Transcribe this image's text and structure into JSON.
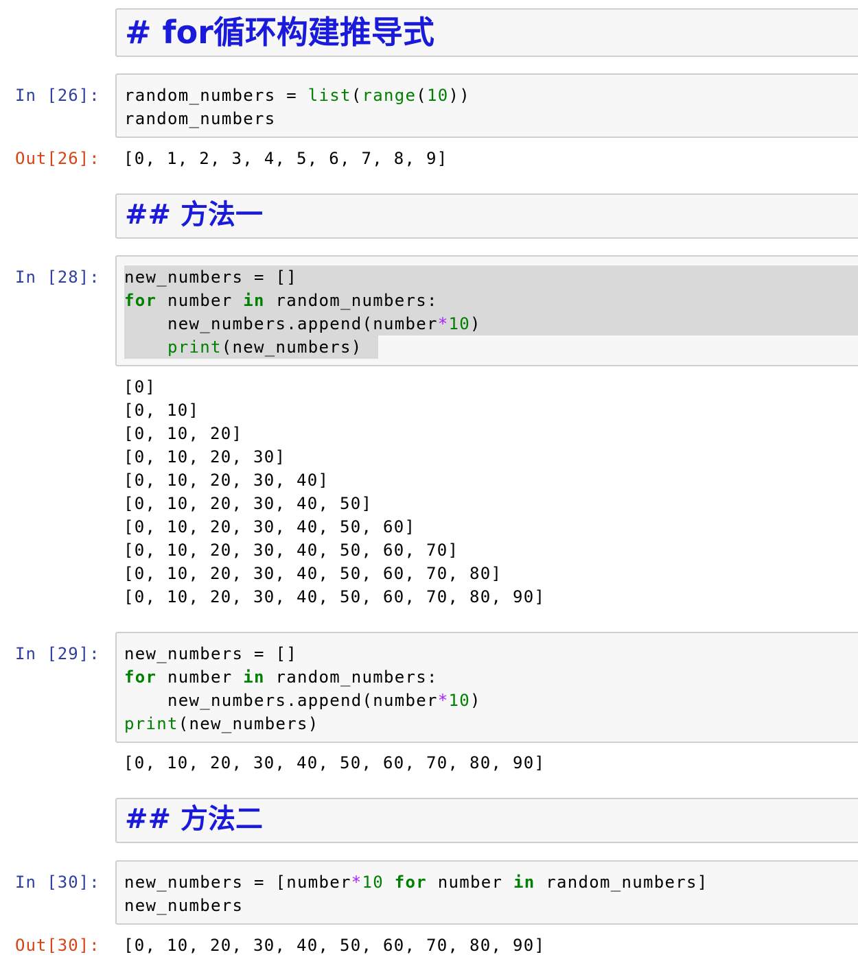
{
  "colors": {
    "in_prompt": "#303F9F",
    "out_prompt": "#D84315",
    "markdown_heading": "#1a1adb",
    "keyword": "#008000",
    "operator": "#aa22ff",
    "cell_background": "#f7f7f7",
    "selection": "#d9d9d9"
  },
  "cells": [
    {
      "type": "markdown",
      "text": "# for循环构建推导式"
    },
    {
      "type": "code",
      "prompt_in": "In [26]:",
      "lines": [
        [
          [
            "t",
            "random_numbers = "
          ],
          [
            "bi",
            "list"
          ],
          [
            "t",
            "("
          ],
          [
            "bi",
            "range"
          ],
          [
            "t",
            "("
          ],
          [
            "num",
            "10"
          ],
          [
            "t",
            "))"
          ]
        ],
        [
          [
            "t",
            "random_numbers"
          ]
        ]
      ],
      "prompt_out": "Out[26]:",
      "output": [
        "[0, 1, 2, 3, 4, 5, 6, 7, 8, 9]"
      ]
    },
    {
      "type": "markdown",
      "text": "## 方法一"
    },
    {
      "type": "code",
      "prompt_in": "In [28]:",
      "lines": [
        [
          [
            "t",
            "new_numbers = []"
          ]
        ],
        [
          [
            "kw",
            "for"
          ],
          [
            "t",
            " number "
          ],
          [
            "kw",
            "in"
          ],
          [
            "t",
            " random_numbers:"
          ]
        ],
        [
          [
            "t",
            "    new_numbers.append(number"
          ],
          [
            "op",
            "*"
          ],
          [
            "num",
            "10"
          ],
          [
            "t",
            ")"
          ]
        ],
        [
          [
            "t",
            "    "
          ],
          [
            "bi",
            "print"
          ],
          [
            "t",
            "(new_numbers)"
          ]
        ]
      ],
      "output": [
        "[0]",
        "[0, 10]",
        "[0, 10, 20]",
        "[0, 10, 20, 30]",
        "[0, 10, 20, 30, 40]",
        "[0, 10, 20, 30, 40, 50]",
        "[0, 10, 20, 30, 40, 50, 60]",
        "[0, 10, 20, 30, 40, 50, 60, 70]",
        "[0, 10, 20, 30, 40, 50, 60, 70, 80]",
        "[0, 10, 20, 30, 40, 50, 60, 70, 80, 90]"
      ]
    },
    {
      "type": "code",
      "prompt_in": "In [29]:",
      "lines": [
        [
          [
            "t",
            "new_numbers = []"
          ]
        ],
        [
          [
            "kw",
            "for"
          ],
          [
            "t",
            " number "
          ],
          [
            "kw",
            "in"
          ],
          [
            "t",
            " random_numbers:"
          ]
        ],
        [
          [
            "t",
            "    new_numbers.append(number"
          ],
          [
            "op",
            "*"
          ],
          [
            "num",
            "10"
          ],
          [
            "t",
            ")"
          ]
        ],
        [
          [
            "bi",
            "print"
          ],
          [
            "t",
            "(new_numbers)"
          ]
        ]
      ],
      "output": [
        "[0, 10, 20, 30, 40, 50, 60, 70, 80, 90]"
      ]
    },
    {
      "type": "markdown",
      "text": "## 方法二"
    },
    {
      "type": "code",
      "prompt_in": "In [30]:",
      "lines": [
        [
          [
            "t",
            "new_numbers = [number"
          ],
          [
            "op",
            "*"
          ],
          [
            "num",
            "10"
          ],
          [
            "t",
            " "
          ],
          [
            "kw",
            "for"
          ],
          [
            "t",
            " number "
          ],
          [
            "kw",
            "in"
          ],
          [
            "t",
            " random_numbers]"
          ]
        ],
        [
          [
            "t",
            "new_numbers"
          ]
        ]
      ],
      "prompt_out": "Out[30]:",
      "output": [
        "[0, 10, 20, 30, 40, 50, 60, 70, 80, 90]"
      ]
    }
  ]
}
